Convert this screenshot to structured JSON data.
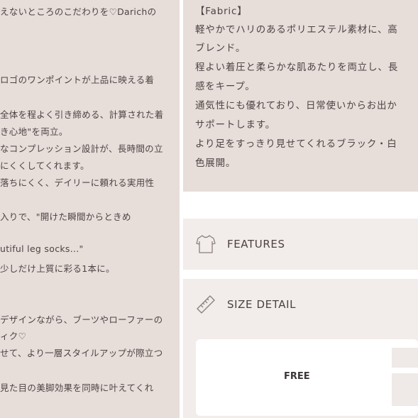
{
  "left_description": {
    "lines": [
      "えないところのこだわりを♡Darichの",
      "",
      "ロゴのワンポイントが上品に映える着",
      "",
      "全体を程よく引き締める、計算された着",
      "き心地\"を両立。",
      "なコンプレッション設計が、長時間の立",
      "にくくしてくれます。",
      "落ちにくく、デイリーに頼れる実用性",
      "",
      "入りで、\"開けた瞬間からときめ",
      "",
      "utiful leg socks...\"",
      "少しだけ上質に彩る1本に。",
      "",
      "",
      "デザインながら、ブーツやローファーの",
      "ィク♡",
      "せて、より一層スタイルアップが際立つ",
      "",
      "見た目の美脚効果を同時に叶えてくれ"
    ]
  },
  "fabric": {
    "heading": "【Fabric】",
    "lines": [
      "軽やかでハリのあるポリエステル素材に、高",
      "ブレンド。",
      "程よい着圧と柔らかな肌あたりを両立し、長",
      "感をキープ。",
      "通気性にも優れており、日常使いからお出か",
      "サポートします。",
      "より足をすっきり見せてくれるブラック・白",
      "色展開。"
    ]
  },
  "accordions": {
    "features": {
      "label": "FEATURES",
      "icon": "tshirt-icon"
    },
    "size_detail": {
      "label": "SIZE DETAIL",
      "icon": "ruler-icon"
    }
  },
  "size_table": {
    "size_label": "FREE"
  },
  "colors": {
    "panel_bg": "#e7ddd9",
    "accordion_bg": "#f2ecea",
    "text": "#4d4545"
  }
}
